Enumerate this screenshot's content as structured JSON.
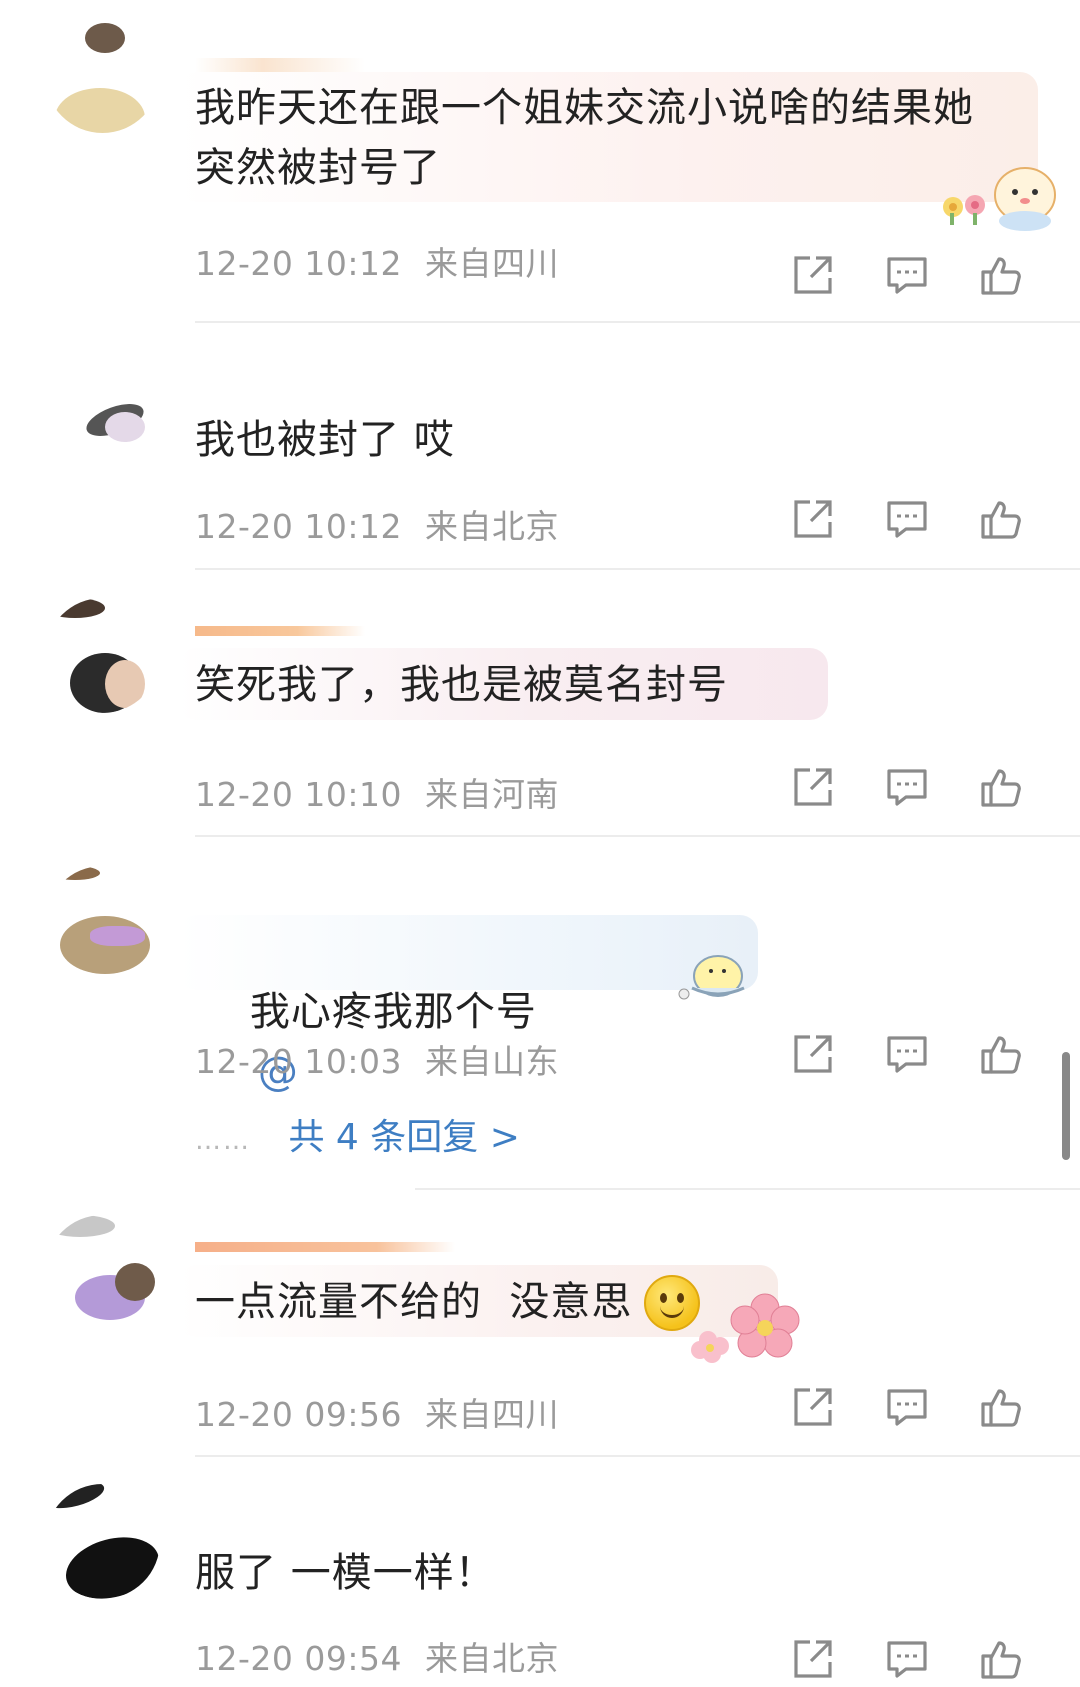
{
  "comments": [
    {
      "text": "我昨天还在跟一个姐妹交流小说啥的结果她\n突然被封号了",
      "time": "12-20 10:12",
      "location": "来自四川"
    },
    {
      "text": "我也被封了 哎",
      "time": "12-20 10:12",
      "location": "来自北京"
    },
    {
      "text": "笑死我了，我也是被莫名封号",
      "time": "12-20 10:10",
      "location": "来自河南"
    },
    {
      "text": "我心疼我那个号",
      "mention": "@",
      "time": "12-20 10:03",
      "location": "来自山东",
      "replies_dots": "……",
      "replies_label": "共 4 条回复 >"
    },
    {
      "text": "一点流量不给的  没意思",
      "time": "12-20 09:56",
      "location": "来自四川"
    },
    {
      "text": "服了 一模一样！",
      "time": "12-20 09:54",
      "location": "来自北京"
    }
  ],
  "icons": {
    "share": "share-icon",
    "comment": "comment-icon",
    "like": "thumbs-up-icon"
  },
  "colors": {
    "accent_link": "#3e7ec3",
    "meta_gray": "#9a9a9a",
    "text": "#222222"
  }
}
